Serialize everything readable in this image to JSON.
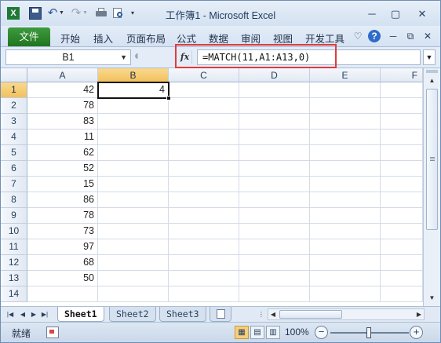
{
  "window": {
    "title": "工作簿1 - Microsoft Excel",
    "minimize": "─",
    "restore": "▢",
    "close": "✕"
  },
  "qat": {
    "excel_icon": "X",
    "save_icon": "save-icon",
    "undo_icon": "↶",
    "redo_icon": "↷"
  },
  "ribbon": {
    "file_tab": "文件",
    "tabs": [
      "开始",
      "插入",
      "页面布局",
      "公式",
      "数据",
      "审阅",
      "视图",
      "开发工具"
    ],
    "help": "?"
  },
  "formula_bar": {
    "name_box": "B1",
    "fx_label": "fx",
    "formula": "=MATCH(11,A1:A13,0)"
  },
  "grid": {
    "columns": [
      "A",
      "B",
      "C",
      "D",
      "E",
      "F"
    ],
    "rows": [
      "1",
      "2",
      "3",
      "4",
      "5",
      "6",
      "7",
      "8",
      "9",
      "10",
      "11",
      "12",
      "13",
      "14"
    ],
    "column_a_values": [
      "42",
      "78",
      "83",
      "11",
      "62",
      "52",
      "15",
      "86",
      "78",
      "73",
      "97",
      "68",
      "50",
      ""
    ],
    "b1_value": "4",
    "active_cell": "B1"
  },
  "sheets": {
    "tabs": [
      "Sheet1",
      "Sheet2",
      "Sheet3"
    ],
    "active": "Sheet1"
  },
  "status": {
    "ready": "就绪",
    "zoom": "100%",
    "zoom_level_percent": 100
  },
  "colors": {
    "file_tab": "#207520",
    "selection_header": "#f2c15e",
    "highlight_box": "#e23b3b"
  }
}
